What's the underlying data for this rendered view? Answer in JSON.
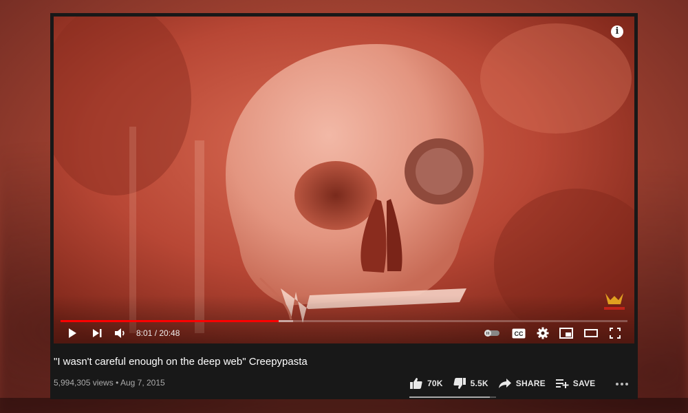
{
  "player": {
    "current_time": "8:01",
    "duration": "20:48",
    "time_display": "8:01 / 20:48",
    "played_fraction": 0.385,
    "buffered_fraction": 0.41,
    "info_label": "i",
    "icons": [
      "play-icon",
      "next-icon",
      "volume-icon",
      "autoplay-toggle-icon",
      "subtitles-icon",
      "settings-icon",
      "miniplayer-icon",
      "theater-icon",
      "fullscreen-icon",
      "info-icon"
    ],
    "subtitles_label": "CC"
  },
  "video": {
    "title": "\"I wasn't careful enough on the deep web\" Creepypasta",
    "views": "5,994,305 views",
    "separator": "•",
    "date": "Aug 7, 2015"
  },
  "actions": {
    "like_count": "70K",
    "dislike_count": "5.5K",
    "share_label": "SHARE",
    "save_label": "SAVE",
    "like_ratio": 0.93
  },
  "colors": {
    "progress_played": "#ff0000",
    "panel_bg": "#181818",
    "video_tint": "#c9553f"
  }
}
